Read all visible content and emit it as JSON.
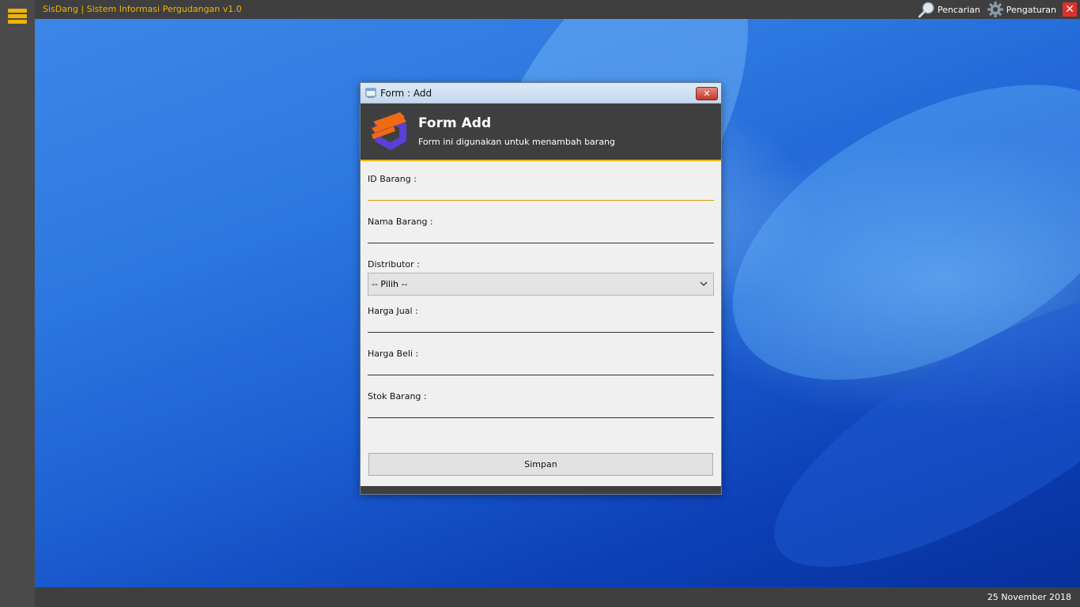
{
  "app": {
    "title": "SisDang | Sistem Informasi Pergudangan v1.0",
    "search_label": "Pencarian",
    "settings_label": "Pengaturan",
    "close_glyph": "✕"
  },
  "status": {
    "date": "25 November 2018"
  },
  "dialog": {
    "window_title": "Form : Add",
    "header_title": "Form Add",
    "header_subtitle": "Form ini digunakan untuk menambah barang",
    "fields": {
      "id_label": "ID Barang :",
      "id_value": "",
      "nama_label": "Nama Barang :",
      "nama_value": "",
      "distributor_label": "Distributor :",
      "distributor_selected": "-- Pilih --",
      "harga_jual_label": "Harga Jual :",
      "harga_jual_value": "",
      "harga_beli_label": "Harga Beli :",
      "harga_beli_value": "",
      "stok_label": "Stok Barang :",
      "stok_value": ""
    },
    "save_label": "Simpan"
  },
  "colors": {
    "accent": "#f0b400",
    "dark_bar": "#3f3f3f",
    "close_red": "#e0302b"
  },
  "icons": [
    "menu-icon",
    "search-icon",
    "gear-icon",
    "close-icon",
    "window-icon",
    "logo-icon",
    "chevron-down-icon"
  ]
}
